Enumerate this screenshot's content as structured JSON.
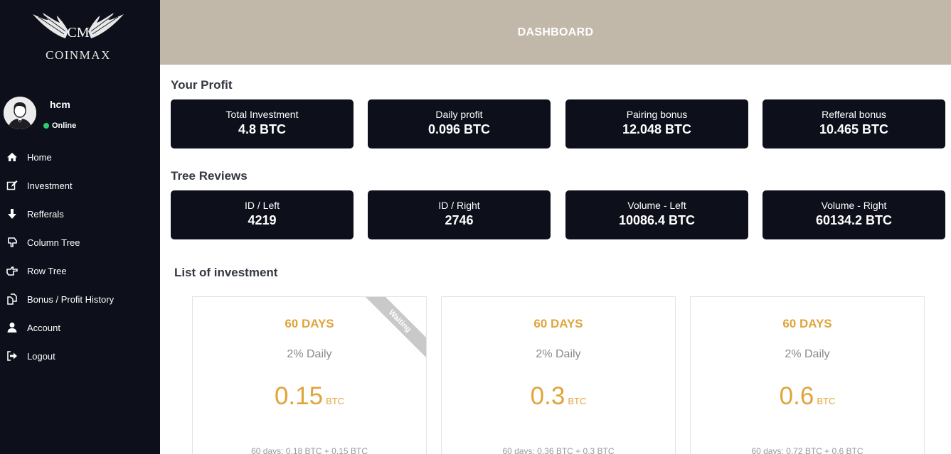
{
  "brand": {
    "initials": "CM",
    "name": "COINMAX"
  },
  "user": {
    "name": "hcm",
    "status": "Online",
    "status_color": "#2ecc71"
  },
  "nav": [
    {
      "label": "Home",
      "icon": "home-icon"
    },
    {
      "label": "Investment",
      "icon": "edit-icon"
    },
    {
      "label": "Refferals",
      "icon": "arrow-down-icon"
    },
    {
      "label": "Column Tree",
      "icon": "hand-down-icon"
    },
    {
      "label": "Row Tree",
      "icon": "hand-right-icon"
    },
    {
      "label": "Bonus / Profit History",
      "icon": "copy-icon"
    },
    {
      "label": "Account",
      "icon": "user-icon"
    },
    {
      "label": "Logout",
      "icon": "sign-out-icon"
    }
  ],
  "header": {
    "title": "DASHBOARD"
  },
  "profit": {
    "title": "Your Profit",
    "cards": [
      {
        "label": "Total Investment",
        "value": "4.8 BTC"
      },
      {
        "label": "Daily profit",
        "value": "0.096 BTC"
      },
      {
        "label": "Pairing bonus",
        "value": "12.048 BTC"
      },
      {
        "label": "Refferal bonus",
        "value": "10.465 BTC"
      }
    ]
  },
  "tree": {
    "title": "Tree Reviews",
    "cards": [
      {
        "label": "ID / Left",
        "value": "4219"
      },
      {
        "label": "ID / Right",
        "value": "2746"
      },
      {
        "label": "Volume - Left",
        "value": "10086.4 BTC"
      },
      {
        "label": "Volume - Right",
        "value": "60134.2 BTC"
      }
    ]
  },
  "investments": {
    "title": "List of investment",
    "plans": [
      {
        "days": "60 DAYS",
        "rate": "2% Daily",
        "amount": "0.15",
        "unit": "BTC",
        "note": "60 days: 0.18 BTC + 0.15 BTC",
        "ribbon": "Waiting"
      },
      {
        "days": "60 DAYS",
        "rate": "2% Daily",
        "amount": "0.3",
        "unit": "BTC",
        "note": "60 days: 0.36 BTC + 0.3 BTC"
      },
      {
        "days": "60 DAYS",
        "rate": "2% Daily",
        "amount": "0.6",
        "unit": "BTC",
        "note": "60 days: 0.72 BTC + 0.6 BTC"
      }
    ]
  },
  "colors": {
    "sidebar_bg": "#0d0f1a",
    "header_bg": "#c2b8aa",
    "accent": "#e0a43a",
    "ribbon": "#c9c9c9"
  }
}
